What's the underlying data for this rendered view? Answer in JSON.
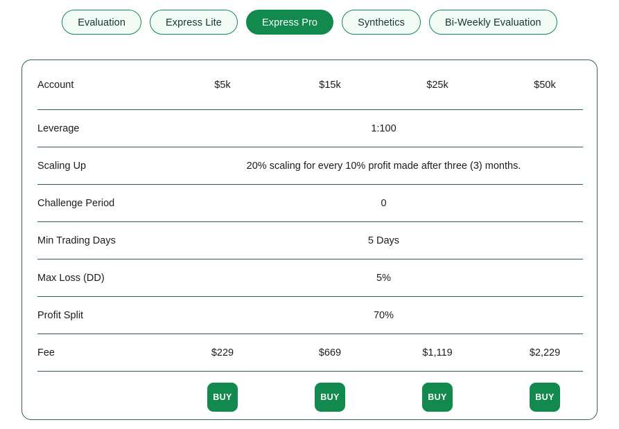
{
  "tabs": [
    {
      "label": "Evaluation",
      "active": false
    },
    {
      "label": "Express Lite",
      "active": false
    },
    {
      "label": "Express Pro",
      "active": true
    },
    {
      "label": "Synthetics",
      "active": false
    },
    {
      "label": "Bi-Weekly Evaluation",
      "active": false
    }
  ],
  "colors": {
    "brand_green": "#128a4e",
    "tab_border": "#16864f",
    "tab_inactive_bg": "#f2fbf6",
    "divider": "#2d5d56",
    "card_border": "#2f6059",
    "text": "#1b1b1b",
    "button_text": "#ffffff"
  },
  "table": {
    "columns": [
      "$5k",
      "$15k",
      "$25k",
      "$50k"
    ],
    "rows": [
      {
        "label": "Account",
        "type": "columns",
        "values": [
          "$5k",
          "$15k",
          "$25k",
          "$50k"
        ]
      },
      {
        "label": "Leverage",
        "type": "span",
        "value": "1:100"
      },
      {
        "label": "Scaling Up",
        "type": "span",
        "value": "20% scaling for every 10% profit made after three (3) months."
      },
      {
        "label": "Challenge Period",
        "type": "span",
        "value": "0"
      },
      {
        "label": "Min Trading Days",
        "type": "span",
        "value": "5 Days"
      },
      {
        "label": "Max Loss (DD)",
        "type": "span",
        "value": "5%"
      },
      {
        "label": "Profit Split",
        "type": "span",
        "value": "70%"
      },
      {
        "label": "Fee",
        "type": "columns",
        "values": [
          "$229",
          "$669",
          "$1,119",
          "$2,229"
        ]
      }
    ],
    "buy_buttons": [
      {
        "label": "BUY"
      },
      {
        "label": "BUY"
      },
      {
        "label": "BUY"
      },
      {
        "label": "BUY"
      }
    ]
  }
}
